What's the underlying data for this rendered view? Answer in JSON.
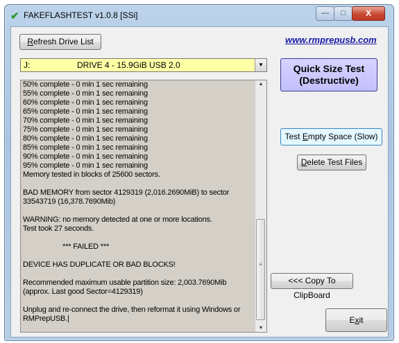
{
  "window": {
    "title": "FAKEFLASHTEST v1.0.8  [SSi]",
    "controls": {
      "minimize": "—",
      "maximize": "□",
      "close": "X"
    }
  },
  "toolbar": {
    "refresh_pre": "",
    "refresh_u": "R",
    "refresh_post": "efresh Drive List",
    "website": "www.rmprepusb.com"
  },
  "drive": {
    "letter": "J:",
    "name": "DRIVE 4 -  15.9GiB USB 2.0"
  },
  "quick_test": {
    "line1": "Quick Size Test",
    "line2": "(Destructive)"
  },
  "log": {
    "text": "50% complete - 0 min 1 sec remaining\n55% complete - 0 min 1 sec remaining\n60% complete - 0 min 1 sec remaining\n65% complete - 0 min 1 sec remaining\n70% complete - 0 min 1 sec remaining\n75% complete - 0 min 1 sec remaining\n80% complete - 0 min 1 sec remaining\n85% complete - 0 min 1 sec remaining\n90% complete - 0 min 1 sec remaining\n95% complete - 0 min 1 sec remaining\nMemory tested in blocks of 25600 sectors.\n\nBAD MEMORY from sector 4129319 (2,016.2690MiB) to sector 33543719 (16,378.7690Mib)\n\nWARNING: no memory detected at one or more locations.\nTest took 27 seconds.\n\n                    *** FAILED ***\n\nDEVICE HAS DUPLICATE OR BAD BLOCKS!\n\nRecommended maximum usable partition size: 2,003.7690Mib (approx. Last good Sector=4129319)\n\nUnplug and re-connect the drive, then reformat it using Windows or RMPrepUSB.|"
  },
  "buttons": {
    "test_empty_pre": "Test ",
    "test_empty_u": "E",
    "test_empty_post": "mpty Space (Slow)",
    "delete_pre": "",
    "delete_u": "D",
    "delete_post": "elete Test Files",
    "copy": "<<< Copy To ClipBoard",
    "exit_pre": "E",
    "exit_u": "x",
    "exit_post": "it"
  },
  "colors": {
    "drive_select_bg": "#ffffa6",
    "quick_test_bg": "#c4c0fb",
    "log_bg": "#d4d0c8",
    "link": "#1a1aa6"
  }
}
